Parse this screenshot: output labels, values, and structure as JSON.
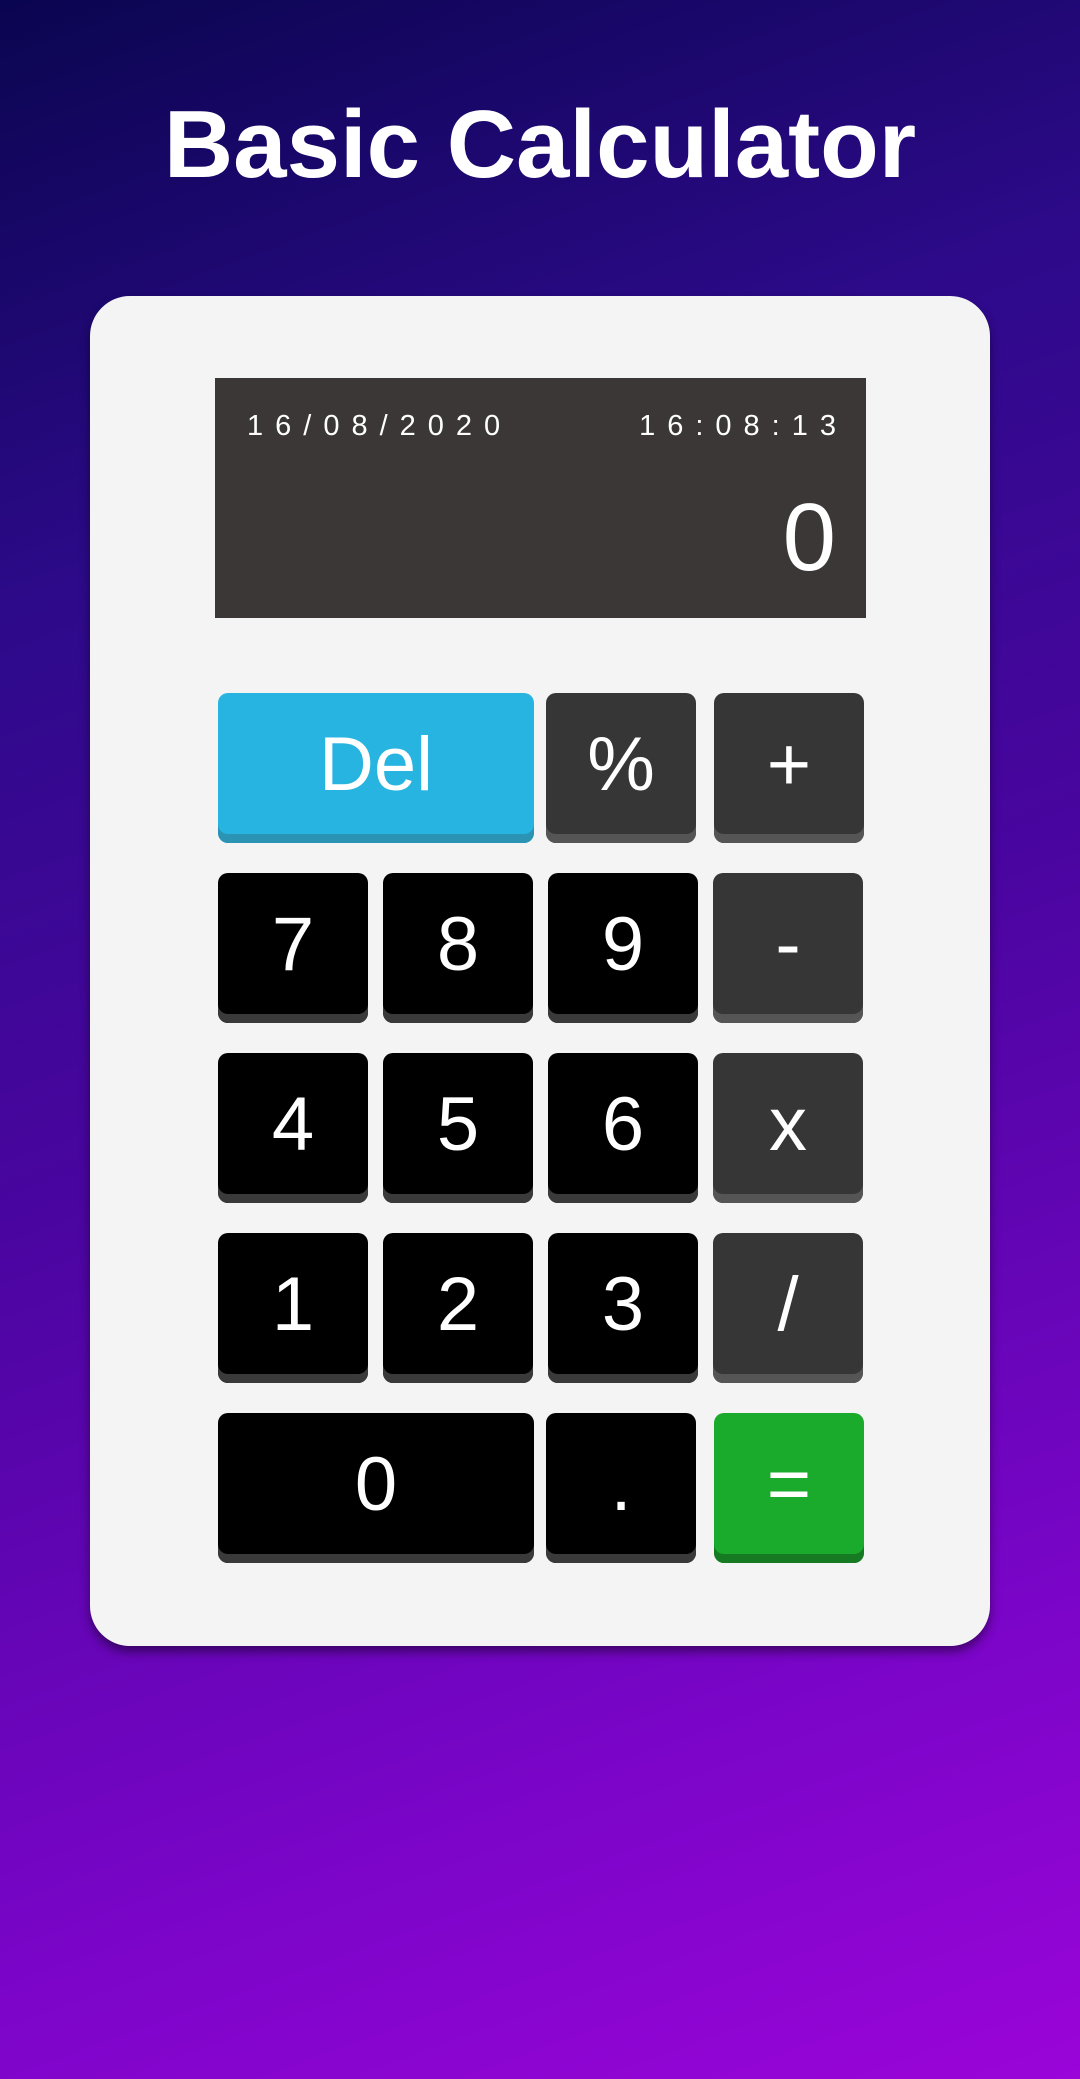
{
  "app": {
    "title": "Basic Calculator"
  },
  "display": {
    "date": "16/08/2020",
    "time": "16:08:13",
    "value": "0"
  },
  "keys": {
    "del": "Del",
    "percent": "%",
    "plus": "+",
    "seven": "7",
    "eight": "8",
    "nine": "9",
    "minus": "-",
    "four": "4",
    "five": "5",
    "six": "6",
    "multiply": "x",
    "one": "1",
    "two": "2",
    "three": "3",
    "divide": "/",
    "zero": "0",
    "dot": ".",
    "equals": "="
  },
  "colors": {
    "del_key": "#28b4e0",
    "equals_key": "#1aaa2c",
    "number_key": "#000000",
    "operator_key": "#363636",
    "display_bg": "#3b3737",
    "card_bg": "#f4f4f4"
  }
}
